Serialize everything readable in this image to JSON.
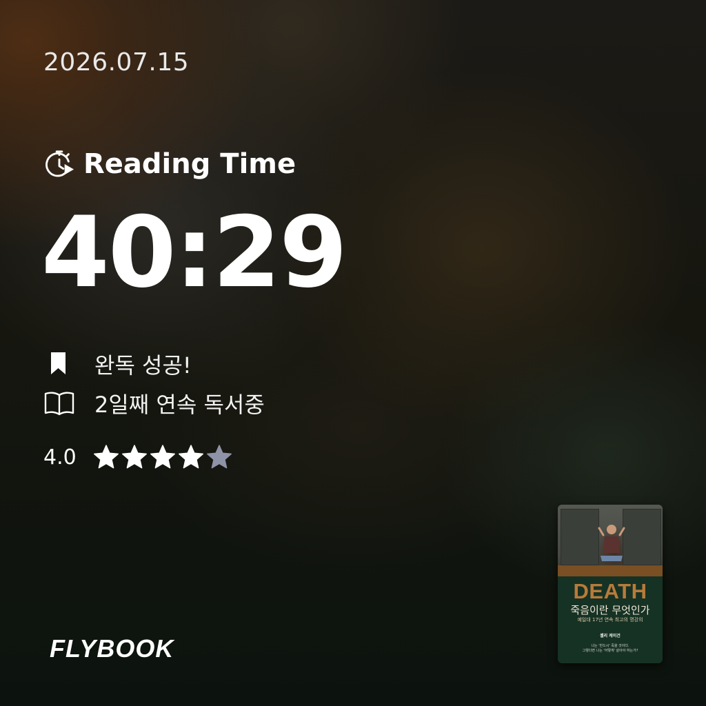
{
  "date": "2026.07.15",
  "reading_time": {
    "label": "Reading Time",
    "icon": "stopwatch-play-icon",
    "value": "40:29"
  },
  "status": {
    "complete": {
      "icon": "bookmark-icon",
      "text": "완독 성공!"
    },
    "streak": {
      "icon": "open-book-icon",
      "text": "2일째 연속 독서중"
    }
  },
  "rating": {
    "value": "4.0",
    "score": 4,
    "max": 5,
    "star_color": "#ffffff",
    "empty_star_color": "#8f93a8"
  },
  "brand": {
    "logo": "FLYBOOK"
  },
  "book": {
    "title": "DEATH",
    "subtitle": "죽음이란 무엇인가",
    "tagline": "예일대 17년 연속 최고의 명강의",
    "author": "셸리 케이건",
    "blurb": [
      "나는 '반드시' 죽을 것이다.",
      "그렇다면 나는 '어떻게' 살아야 하는가?"
    ],
    "cover_bg": "#163224",
    "title_color": "#b77b3b"
  }
}
